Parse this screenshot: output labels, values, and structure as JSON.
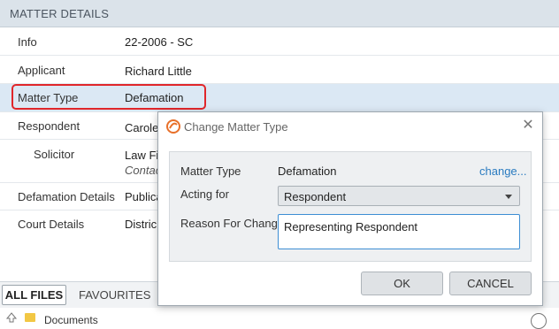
{
  "header": {
    "title": "MATTER DETAILS"
  },
  "details": [
    {
      "label": "Info",
      "value": "22-2006 - SC"
    },
    {
      "label": "Applicant",
      "value": "Richard Little"
    },
    {
      "label": "Matter Type",
      "value": "Defamation"
    },
    {
      "label": "Respondent",
      "value": "Carole"
    },
    {
      "label": "Solicitor",
      "value": "Law Fi",
      "sub": "Contac"
    },
    {
      "label": "Defamation Details",
      "value": "Publica"
    },
    {
      "label": "Court Details",
      "value": "Distric"
    }
  ],
  "tabs": {
    "all_files": "ALL FILES",
    "favourites": "FAVOURITES"
  },
  "files": {
    "folder": "Documents"
  },
  "dialog": {
    "title": "Change Matter Type",
    "close_glyph": "✕",
    "matter_type_label": "Matter Type",
    "matter_type_value": "Defamation",
    "change_link": "change...",
    "acting_for_label": "Acting for",
    "acting_for_value": "Respondent",
    "reason_label": "Reason For Change",
    "reason_value": "Representing Respondent",
    "ok_label": "OK",
    "cancel_label": "CANCEL"
  },
  "colors": {
    "highlight": "#e0262a",
    "selected_row": "#dbe8f4",
    "link": "#2a7bc0",
    "logo": "#e8702a"
  }
}
